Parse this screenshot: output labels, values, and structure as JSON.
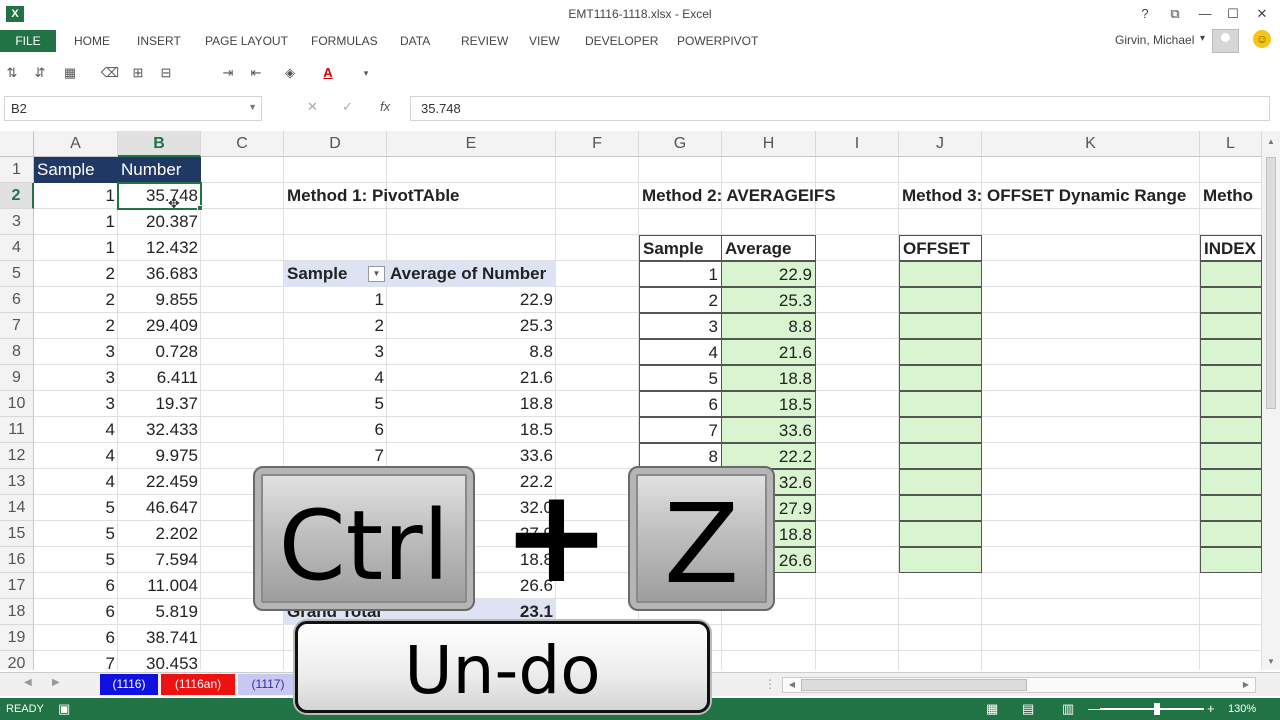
{
  "window": {
    "app_icon": "X",
    "title": "EMT1116-1118.xlsx - Excel",
    "help": "?",
    "restore_ribbon": "⧉",
    "minimize": "—",
    "maximize": "☐",
    "close": "✕"
  },
  "ribbon": {
    "file": "FILE",
    "tabs": [
      "HOME",
      "INSERT",
      "PAGE LAYOUT",
      "FORMULAS",
      "DATA",
      "REVIEW",
      "VIEW",
      "DEVELOPER",
      "POWERPIVOT"
    ],
    "user": "Girvin, Michael",
    "user_caret": "▾",
    "smiley": "☺"
  },
  "toolbar": {
    "icons": [
      "sort-icon",
      "filter-icon",
      "table-format-icon",
      "clear-icon",
      "borders-icon",
      "merge-icon",
      "indent-increase-icon",
      "indent-decrease-icon",
      "fill-color-icon",
      "font-color-icon",
      "more-icon"
    ],
    "glyphs": [
      "⇅",
      "⇵",
      "▦",
      "⌫",
      "⊞",
      "⊟",
      "⇥",
      "⇤",
      "◈",
      "A",
      "▾"
    ],
    "font_color_accent": "#d00000"
  },
  "formula_bar": {
    "name_box": "B2",
    "cancel": "✕",
    "enter": "✓",
    "fx": "fx",
    "value": "35.748"
  },
  "columns": [
    "A",
    "B",
    "C",
    "D",
    "E",
    "F",
    "G",
    "H",
    "I",
    "J",
    "K",
    "L"
  ],
  "rows": [
    "1",
    "2",
    "3",
    "4",
    "5",
    "6",
    "7",
    "8",
    "9",
    "10",
    "11",
    "12",
    "13",
    "14",
    "15",
    "16",
    "17",
    "18",
    "19",
    "20"
  ],
  "table_a": {
    "header_sample": "Sample",
    "header_number": "Number",
    "samples": [
      "1",
      "1",
      "1",
      "2",
      "2",
      "2",
      "3",
      "3",
      "3",
      "4",
      "4",
      "4",
      "5",
      "5",
      "5",
      "6",
      "6",
      "6",
      "7"
    ],
    "numbers": [
      "35.748",
      "20.387",
      "12.432",
      "36.683",
      "9.855",
      "29.409",
      "0.728",
      "6.411",
      "19.37",
      "32.433",
      "9.975",
      "22.459",
      "46.647",
      "2.202",
      "7.594",
      "11.004",
      "5.819",
      "38.741",
      "30.453"
    ]
  },
  "method1": {
    "title": "Method 1: PivotTAble",
    "header_sample": "Sample",
    "header_average": "Average of Number",
    "samples": [
      "1",
      "2",
      "3",
      "4",
      "5",
      "6",
      "7"
    ],
    "averages": [
      "22.9",
      "25.3",
      "8.8",
      "21.6",
      "18.8",
      "18.5",
      "33.6",
      "22.2",
      "32.0",
      "27.9",
      "18.8",
      "26.6"
    ],
    "grand_total_label": "Grand Total",
    "grand_total": "23.1"
  },
  "method2": {
    "title": "Method 2: AVERAGEIFS",
    "header_sample": "Sample",
    "header_average": "Average",
    "samples": [
      "1",
      "2",
      "3",
      "4",
      "5",
      "6",
      "7",
      "8"
    ],
    "averages": [
      "22.9",
      "25.3",
      "8.8",
      "21.6",
      "18.8",
      "18.5",
      "33.6",
      "22.2",
      "32.6",
      "27.9",
      "18.8",
      "26.6"
    ]
  },
  "method3": {
    "title": "Method 3: OFFSET Dynamic Range",
    "header": "OFFSET"
  },
  "method4": {
    "title": "Metho",
    "header": "INDEX"
  },
  "sheets": {
    "nav_prev": "◀",
    "nav_next": "▶",
    "tabs": [
      {
        "label": "(1116)",
        "color": "#1010e0",
        "text": "#ffffff"
      },
      {
        "label": "(1116an)",
        "color": "#ee1111",
        "text": "#ffffff"
      },
      {
        "label": "(1117)",
        "color": "#c8c8f0",
        "text": "#3030a0"
      }
    ]
  },
  "status": {
    "ready": "READY",
    "zoom": "130%",
    "normal_view": "▦",
    "page_layout_view": "▤",
    "page_break_view": "▥",
    "zoom_out": "—",
    "zoom_in": "+"
  },
  "overlay": {
    "key1": "Ctrl",
    "plus": "+",
    "key2": "Z",
    "caption": "Un-do"
  },
  "colors": {
    "excel_green": "#217346",
    "header_blue": "#1f3864",
    "result_green": "#d8f5d0",
    "pivot_header": "#dde3f3"
  }
}
